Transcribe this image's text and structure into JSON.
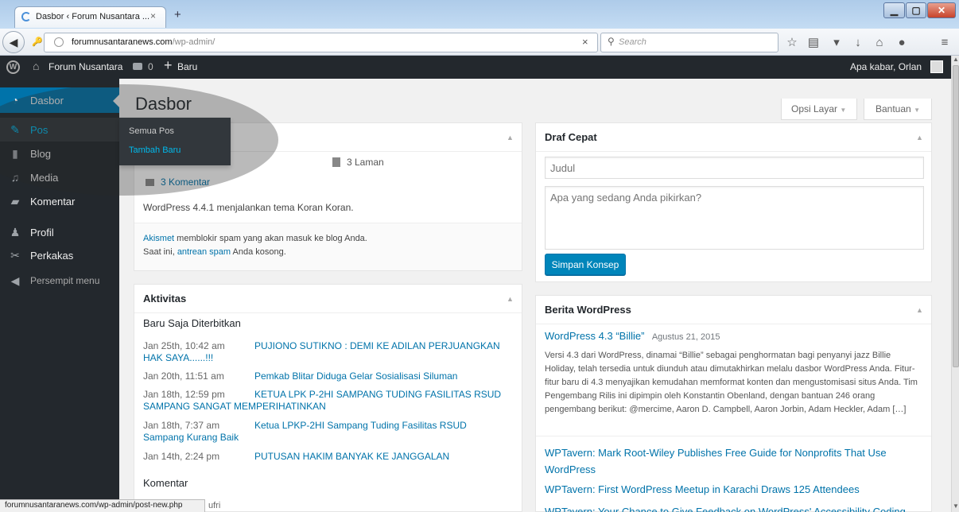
{
  "browser": {
    "tab_title": "Dasbor ‹ Forum Nusantara ...",
    "tab_close": "×",
    "new_tab": "+",
    "url_domain": "forumnusantaranews.com",
    "url_path": "/wp-admin/",
    "url_clear": "×",
    "search_placeholder": "Search",
    "status_url": "forumnusantaranews.com/wp-admin/post-new.php"
  },
  "adminbar": {
    "site_name": "Forum Nusantara",
    "comments_count": "0",
    "new_label": "Baru",
    "greeting": "Apa kabar, Orlan"
  },
  "sidebar": {
    "items": [
      {
        "label": "Dasbor"
      },
      {
        "label": "Pos"
      },
      {
        "label": "Blog"
      },
      {
        "label": "Media"
      },
      {
        "label": "Komentar"
      },
      {
        "label": "Profil"
      },
      {
        "label": "Perkakas"
      },
      {
        "label": "Persempit menu"
      }
    ],
    "flyout": [
      "Semua Pos",
      "Tambah Baru"
    ]
  },
  "page": {
    "title": "Dasbor",
    "screen_options": "Opsi Layar",
    "help": "Bantuan"
  },
  "glance": {
    "pages": "3 Laman",
    "comments": "3 Komentar",
    "wp_version": "WordPress 4.4.1 menjalankan tema Koran Koran.",
    "akismet_link": "Akismet",
    "akismet_text": " memblokir spam yang akan masuk ke blog Anda.",
    "spam_prefix": "Saat ini, ",
    "spam_link": "antrean spam",
    "spam_suffix": " Anda kosong."
  },
  "activity": {
    "title": "Aktivitas",
    "published_heading": "Baru Saja Diterbitkan",
    "posts": [
      {
        "date": "Jan 25th, 10:42 am",
        "title": "PUJIONO SUTIKNO : DEMI KE ADILAN PERJUANGKAN HAK SAYA......!!!"
      },
      {
        "date": "Jan 20th, 11:51 am",
        "title": "Pemkab Blitar Diduga Gelar Sosialisasi Siluman"
      },
      {
        "date": "Jan 18th, 12:59 pm",
        "title": "KETUA LPK P-2HI SAMPANG TUDING FASILITAS RSUD SAMPANG SANGAT MEMPERIHATINKAN"
      },
      {
        "date": "Jan 18th, 7:37 am",
        "title": "Ketua LPKP-2HI Sampang Tuding Fasilitas RSUD Sampang Kurang Baik"
      },
      {
        "date": "Jan 14th, 2:24 pm",
        "title": "PUTUSAN HAKIM BANYAK KE JANGGALAN"
      }
    ],
    "comments_heading": "Komentar",
    "comment_partial": "ufri"
  },
  "quickdraft": {
    "title": "Draf Cepat",
    "title_placeholder": "Judul",
    "content_placeholder": "Apa yang sedang Anda pikirkan?",
    "save_button": "Simpan Konsep"
  },
  "news": {
    "title": "Berita WordPress",
    "lead_title": "WordPress 4.3 “Billie”",
    "lead_date": "Agustus 21, 2015",
    "lead_excerpt": "Versi 4.3 dari WordPress, dinamai “Billie” sebagai penghormatan bagi penyanyi jazz Billie Holiday, telah tersedia untuk diunduh atau dimutakhirkan melalu dasbor WordPress Anda. Fitur-fitur baru di 4.3 menyajikan kemudahan memformat konten dan mengustomisasi situs Anda. Tim Pengembang Rilis ini dipimpin oleh Konstantin Obenland, dengan bantuan 246 orang pengembang berikut: @mercime, Aaron D. Campbell, Aaron Jorbin, Adam Heckler, Adam […]",
    "links": [
      "WPTavern: Mark Root-Wiley Publishes Free Guide for Nonprofits That Use WordPress",
      "WPTavern: First WordPress Meetup in Karachi Draws 125 Attendees",
      "WPTavern: Your Chance to Give Feedback on WordPress' Accessibility Coding"
    ]
  }
}
